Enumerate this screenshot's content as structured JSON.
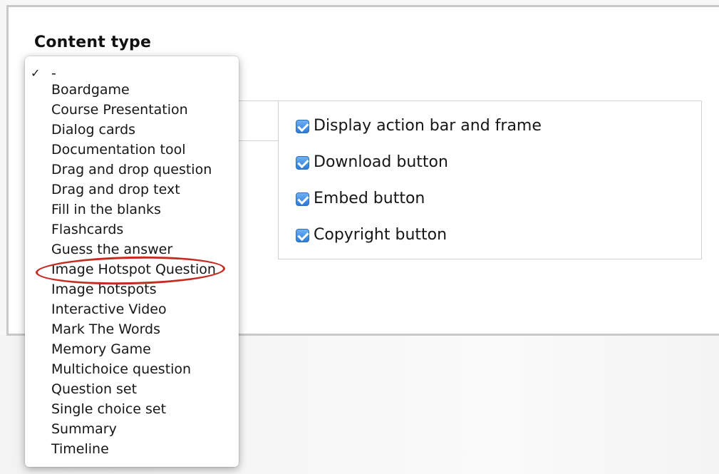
{
  "form": {
    "label": "Content type"
  },
  "dropdown": {
    "selected_marker": "✓",
    "items": [
      "-",
      "Boardgame",
      "Course Presentation",
      "Dialog cards",
      "Documentation tool",
      "Drag and drop question",
      "Drag and drop text",
      "Fill in the blanks",
      "Flashcards",
      "Guess the answer",
      "Image Hotspot Question",
      "Image hotspots",
      "Interactive Video",
      "Mark The Words",
      "Memory Game",
      "Multichoice question",
      "Question set",
      "Single choice set",
      "Summary",
      "Timeline"
    ],
    "highlighted_item": "Image Hotspot Question"
  },
  "options": [
    {
      "label": "Display action bar and frame",
      "checked": true
    },
    {
      "label": "Download button",
      "checked": true
    },
    {
      "label": "Embed button",
      "checked": true
    },
    {
      "label": "Copyright button",
      "checked": true
    }
  ],
  "colors": {
    "highlight": "#c42c22",
    "checkbox": "#2c7bd9"
  }
}
